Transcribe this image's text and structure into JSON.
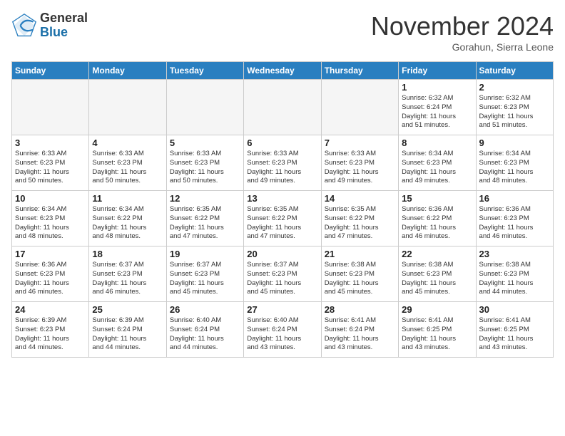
{
  "header": {
    "logo_general": "General",
    "logo_blue": "Blue",
    "month_title": "November 2024",
    "location": "Gorahun, Sierra Leone"
  },
  "days_of_week": [
    "Sunday",
    "Monday",
    "Tuesday",
    "Wednesday",
    "Thursday",
    "Friday",
    "Saturday"
  ],
  "weeks": [
    [
      {
        "day": "",
        "info": ""
      },
      {
        "day": "",
        "info": ""
      },
      {
        "day": "",
        "info": ""
      },
      {
        "day": "",
        "info": ""
      },
      {
        "day": "",
        "info": ""
      },
      {
        "day": "1",
        "info": "Sunrise: 6:32 AM\nSunset: 6:24 PM\nDaylight: 11 hours\nand 51 minutes."
      },
      {
        "day": "2",
        "info": "Sunrise: 6:32 AM\nSunset: 6:23 PM\nDaylight: 11 hours\nand 51 minutes."
      }
    ],
    [
      {
        "day": "3",
        "info": "Sunrise: 6:33 AM\nSunset: 6:23 PM\nDaylight: 11 hours\nand 50 minutes."
      },
      {
        "day": "4",
        "info": "Sunrise: 6:33 AM\nSunset: 6:23 PM\nDaylight: 11 hours\nand 50 minutes."
      },
      {
        "day": "5",
        "info": "Sunrise: 6:33 AM\nSunset: 6:23 PM\nDaylight: 11 hours\nand 50 minutes."
      },
      {
        "day": "6",
        "info": "Sunrise: 6:33 AM\nSunset: 6:23 PM\nDaylight: 11 hours\nand 49 minutes."
      },
      {
        "day": "7",
        "info": "Sunrise: 6:33 AM\nSunset: 6:23 PM\nDaylight: 11 hours\nand 49 minutes."
      },
      {
        "day": "8",
        "info": "Sunrise: 6:34 AM\nSunset: 6:23 PM\nDaylight: 11 hours\nand 49 minutes."
      },
      {
        "day": "9",
        "info": "Sunrise: 6:34 AM\nSunset: 6:23 PM\nDaylight: 11 hours\nand 48 minutes."
      }
    ],
    [
      {
        "day": "10",
        "info": "Sunrise: 6:34 AM\nSunset: 6:23 PM\nDaylight: 11 hours\nand 48 minutes."
      },
      {
        "day": "11",
        "info": "Sunrise: 6:34 AM\nSunset: 6:22 PM\nDaylight: 11 hours\nand 48 minutes."
      },
      {
        "day": "12",
        "info": "Sunrise: 6:35 AM\nSunset: 6:22 PM\nDaylight: 11 hours\nand 47 minutes."
      },
      {
        "day": "13",
        "info": "Sunrise: 6:35 AM\nSunset: 6:22 PM\nDaylight: 11 hours\nand 47 minutes."
      },
      {
        "day": "14",
        "info": "Sunrise: 6:35 AM\nSunset: 6:22 PM\nDaylight: 11 hours\nand 47 minutes."
      },
      {
        "day": "15",
        "info": "Sunrise: 6:36 AM\nSunset: 6:22 PM\nDaylight: 11 hours\nand 46 minutes."
      },
      {
        "day": "16",
        "info": "Sunrise: 6:36 AM\nSunset: 6:23 PM\nDaylight: 11 hours\nand 46 minutes."
      }
    ],
    [
      {
        "day": "17",
        "info": "Sunrise: 6:36 AM\nSunset: 6:23 PM\nDaylight: 11 hours\nand 46 minutes."
      },
      {
        "day": "18",
        "info": "Sunrise: 6:37 AM\nSunset: 6:23 PM\nDaylight: 11 hours\nand 46 minutes."
      },
      {
        "day": "19",
        "info": "Sunrise: 6:37 AM\nSunset: 6:23 PM\nDaylight: 11 hours\nand 45 minutes."
      },
      {
        "day": "20",
        "info": "Sunrise: 6:37 AM\nSunset: 6:23 PM\nDaylight: 11 hours\nand 45 minutes."
      },
      {
        "day": "21",
        "info": "Sunrise: 6:38 AM\nSunset: 6:23 PM\nDaylight: 11 hours\nand 45 minutes."
      },
      {
        "day": "22",
        "info": "Sunrise: 6:38 AM\nSunset: 6:23 PM\nDaylight: 11 hours\nand 45 minutes."
      },
      {
        "day": "23",
        "info": "Sunrise: 6:38 AM\nSunset: 6:23 PM\nDaylight: 11 hours\nand 44 minutes."
      }
    ],
    [
      {
        "day": "24",
        "info": "Sunrise: 6:39 AM\nSunset: 6:23 PM\nDaylight: 11 hours\nand 44 minutes."
      },
      {
        "day": "25",
        "info": "Sunrise: 6:39 AM\nSunset: 6:24 PM\nDaylight: 11 hours\nand 44 minutes."
      },
      {
        "day": "26",
        "info": "Sunrise: 6:40 AM\nSunset: 6:24 PM\nDaylight: 11 hours\nand 44 minutes."
      },
      {
        "day": "27",
        "info": "Sunrise: 6:40 AM\nSunset: 6:24 PM\nDaylight: 11 hours\nand 43 minutes."
      },
      {
        "day": "28",
        "info": "Sunrise: 6:41 AM\nSunset: 6:24 PM\nDaylight: 11 hours\nand 43 minutes."
      },
      {
        "day": "29",
        "info": "Sunrise: 6:41 AM\nSunset: 6:25 PM\nDaylight: 11 hours\nand 43 minutes."
      },
      {
        "day": "30",
        "info": "Sunrise: 6:41 AM\nSunset: 6:25 PM\nDaylight: 11 hours\nand 43 minutes."
      }
    ]
  ]
}
